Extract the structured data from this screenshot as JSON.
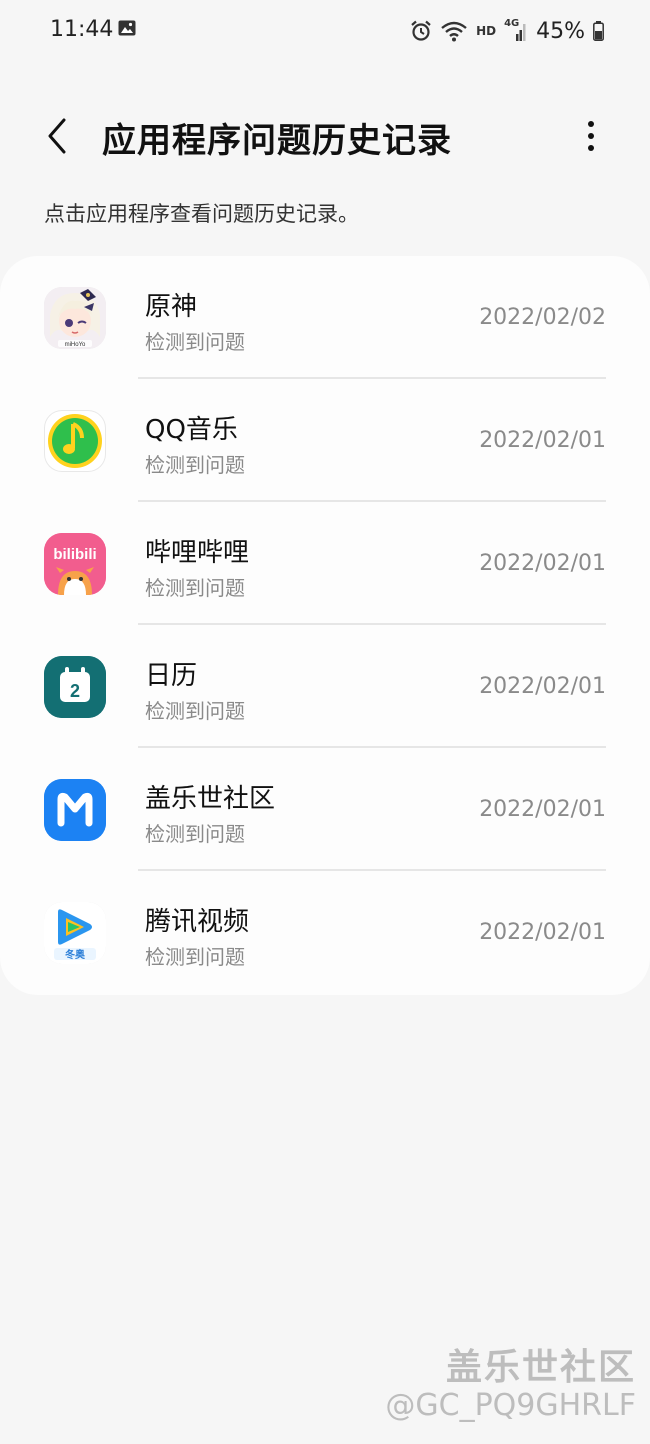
{
  "status_bar": {
    "time": "11:44",
    "network": "HD",
    "network_type": "4G",
    "battery": "45%"
  },
  "header": {
    "title": "应用程序问题历史记录",
    "subtitle": "点击应用程序查看问题历史记录。"
  },
  "apps": [
    {
      "name": "原神",
      "status": "检测到问题",
      "date": "2022/02/02",
      "icon": "genshin-icon"
    },
    {
      "name": "QQ音乐",
      "status": "检测到问题",
      "date": "2022/02/01",
      "icon": "qq-music-icon"
    },
    {
      "name": "哔哩哔哩",
      "status": "检测到问题",
      "date": "2022/02/01",
      "icon": "bilibili-icon",
      "icon_text": "bilibili"
    },
    {
      "name": "日历",
      "status": "检测到问题",
      "date": "2022/02/01",
      "icon": "calendar-icon",
      "icon_text": "2"
    },
    {
      "name": "盖乐世社区",
      "status": "检测到问题",
      "date": "2022/02/01",
      "icon": "samsung-members-icon"
    },
    {
      "name": "腾讯视频",
      "status": "检测到问题",
      "date": "2022/02/01",
      "icon": "tencent-video-icon",
      "icon_text": "冬奥"
    }
  ],
  "watermark": {
    "line1": "盖乐世社区",
    "line2": "@GC_PQ9GHRLF"
  },
  "colors": {
    "background": "#f6f6f6",
    "card": "#fdfdfd",
    "secondary_text": "#8a8a8a",
    "qq_green": "#2fbf4c",
    "qq_yellow": "#ffd21e",
    "bilibili_pink": "#f25d8e",
    "calendar_teal": "#136f73",
    "samsung_blue": "#1c82f3",
    "tencent_video_blue": "#2b96ef"
  }
}
